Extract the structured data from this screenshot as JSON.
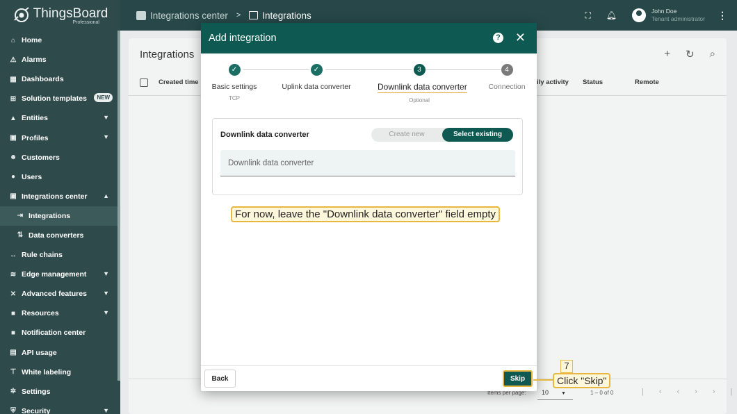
{
  "app": {
    "name": "ThingsBoard",
    "edition": "Professional"
  },
  "sidebar": {
    "items": [
      {
        "label": "Home",
        "icon": "home-icon",
        "glyph": "⌂"
      },
      {
        "label": "Alarms",
        "icon": "alarm-icon",
        "glyph": "⚠"
      },
      {
        "label": "Dashboards",
        "icon": "dashboard-icon",
        "glyph": "▦"
      },
      {
        "label": "Solution templates",
        "icon": "grid-icon",
        "glyph": "⊞",
        "badge": "NEW"
      },
      {
        "label": "Entities",
        "icon": "entities-icon",
        "glyph": "▲",
        "chevron": "▼"
      },
      {
        "label": "Profiles",
        "icon": "profiles-icon",
        "glyph": "▣",
        "chevron": "▼"
      },
      {
        "label": "Customers",
        "icon": "customers-icon",
        "glyph": "☻"
      },
      {
        "label": "Users",
        "icon": "users-icon",
        "glyph": "●"
      },
      {
        "label": "Integrations center",
        "icon": "integrations-icon",
        "glyph": "▣",
        "chevron": "▲"
      },
      {
        "label": "Integrations",
        "icon": "integration-icon",
        "glyph": "⇥",
        "sub": true,
        "active": true
      },
      {
        "label": "Data converters",
        "icon": "converter-icon",
        "glyph": "⇅",
        "sub": true
      },
      {
        "label": "Rule chains",
        "icon": "rule-chain-icon",
        "glyph": "↔"
      },
      {
        "label": "Edge management",
        "icon": "edge-icon",
        "glyph": "≋",
        "chevron": "▼"
      },
      {
        "label": "Advanced features",
        "icon": "tools-icon",
        "glyph": "✕",
        "chevron": "▼"
      },
      {
        "label": "Resources",
        "icon": "folder-icon",
        "glyph": "■",
        "chevron": "▼"
      },
      {
        "label": "Notification center",
        "icon": "notification-icon",
        "glyph": "■"
      },
      {
        "label": "API usage",
        "icon": "api-icon",
        "glyph": "▤"
      },
      {
        "label": "White labeling",
        "icon": "brush-icon",
        "glyph": "⊤"
      },
      {
        "label": "Settings",
        "icon": "settings-icon",
        "glyph": "✲"
      },
      {
        "label": "Security",
        "icon": "security-icon",
        "glyph": "⛨",
        "chevron": "▼"
      }
    ]
  },
  "topbar": {
    "crumb_parent": "Integrations center",
    "crumb_sep": ">",
    "crumb_current": "Integrations",
    "user_name": "John Doe",
    "user_role": "Tenant administrator"
  },
  "page": {
    "title": "Integrations",
    "columns": [
      "Created time",
      "ily activity",
      "Status",
      "Remote"
    ],
    "items_per_page_label": "Items per page:",
    "items_per_page": "10",
    "range": "1 – 0 of 0"
  },
  "dialog": {
    "title": "Add integration",
    "steps": [
      {
        "num": "✓",
        "label": "Basic settings",
        "sub": "TCP",
        "state": "done"
      },
      {
        "num": "✓",
        "label": "Uplink data converter",
        "sub": "",
        "state": "done"
      },
      {
        "num": "3",
        "label": "Downlink data converter",
        "sub": "Optional",
        "state": "current"
      },
      {
        "num": "4",
        "label": "Connection",
        "sub": "",
        "state": "todo"
      }
    ],
    "panel_title": "Downlink data converter",
    "toggle_create": "Create new",
    "toggle_select": "Select existing",
    "field_placeholder": "Downlink data converter",
    "back_label": "Back",
    "skip_label": "Skip"
  },
  "annotations": {
    "hint": "For now, leave the \"Downlink data converter\" field empty",
    "step_number": "7",
    "click_hint": "Click \"Skip\""
  },
  "colors": {
    "primary": "#0e5a52",
    "sidebar": "#2f4a4b",
    "topbar": "#274748",
    "highlight": "#e8b740"
  }
}
